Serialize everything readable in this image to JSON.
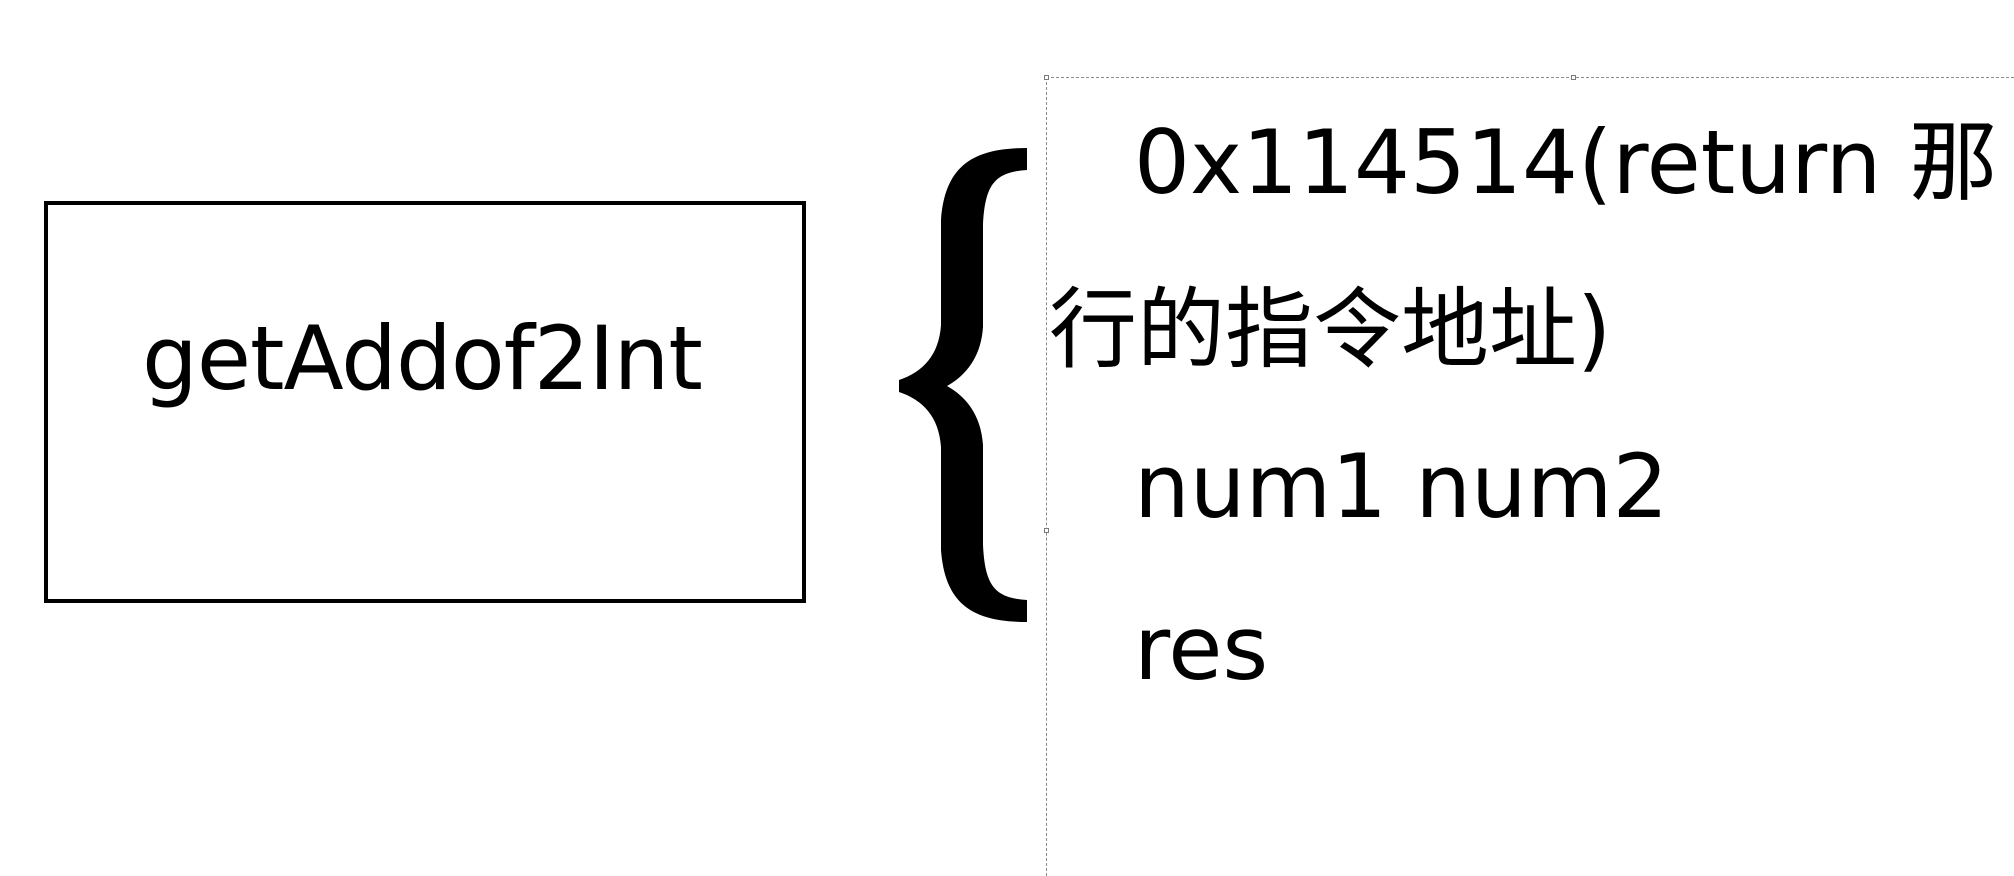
{
  "function_box": {
    "label": "getAddof2Int"
  },
  "stack_frame": {
    "return_address": "0x114514(return 那",
    "return_address_cont": "行的指令地址)",
    "params": "num1 num2",
    "local": "res"
  }
}
